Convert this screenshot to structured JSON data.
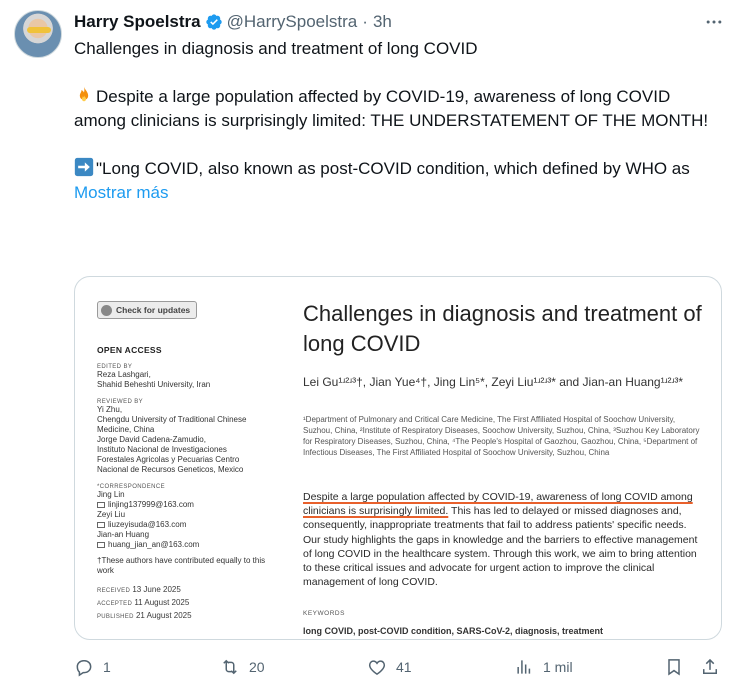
{
  "author": {
    "name": "Harry Spoelstra",
    "handle": "@HarrySpoelstra",
    "time": "3h"
  },
  "tweet": {
    "line1": "Challenges in diagnosis and treatment of long COVID",
    "para2": "Despite a large population affected by COVID-19, awareness of long COVID among clinicians is surprisingly limited: THE UNDERSTATEMENT OF THE MONTH!",
    "para3": "\"Long COVID, also known as post-COVID condition, which defined by WHO as",
    "show_more": "Mostrar más"
  },
  "paper": {
    "check_updates": "Check for updates",
    "open_access": "OPEN ACCESS",
    "edited_by_label": "EDITED BY",
    "edited_by": [
      "Reza Lashgari,",
      "Shahid Beheshti University, Iran"
    ],
    "reviewed_by_label": "REVIEWED BY",
    "reviewed_by": [
      "Yi Zhu,",
      "Chengdu University of Traditional Chinese",
      "Medicine, China",
      "Jorge David Cadena-Zamudio,",
      "Instituto Nacional de Investigaciones",
      "Forestales Agricolas y Pecuarias Centro",
      "Nacional de Recursos Geneticos, Mexico"
    ],
    "correspondence_label": "*CORRESPONDENCE",
    "correspondence": [
      {
        "name": "Jing Lin",
        "email": "linjing137999@163.com"
      },
      {
        "name": "Zeyi Liu",
        "email": "liuzeyisuda@163.com"
      },
      {
        "name": "Jian-an Huang",
        "email": "huang_jian_an@163.com"
      }
    ],
    "contrib_note": "†These authors have contributed equally to this work",
    "received_label": "RECEIVED",
    "received": "13 June 2025",
    "accepted_label": "ACCEPTED",
    "accepted": "11 August 2025",
    "published_label": "PUBLISHED",
    "published": "21 August 2025",
    "title": "Challenges in diagnosis and treatment of long COVID",
    "authors": "Lei Gu¹ʴ²ʴ³†, Jian Yue⁴†, Jing Lin⁵*, Zeyi Liu¹ʴ²ʴ³* and Jian-an Huang¹ʴ²ʴ³*",
    "affiliations": "¹Department of Pulmonary and Critical Care Medicine, The First Affiliated Hospital of Soochow University, Suzhou, China, ²Institute of Respiratory Diseases, Soochow University, Suzhou, China, ³Suzhou Key Laboratory for Respiratory Diseases, Suzhou, China, ⁴The People's Hospital of Gaozhou, Gaozhou, China, ⁵Department of Infectious Diseases, The First Affiliated Hospital of Soochow University, Suzhou, China",
    "abstract_highlight": "Despite a large population affected by COVID-19, awareness of long COVID among clinicians is surprisingly limited.",
    "abstract_rest": " This has led to delayed or missed diagnoses and, consequently, inappropriate treatments that fail to address patients' specific needs. Our study highlights the gaps in knowledge and the barriers to effective management of long COVID in the healthcare system. Through this work, we aim to bring attention to these critical issues and advocate for urgent action to improve the clinical management of long COVID.",
    "keywords_label": "KEYWORDS",
    "keywords": "long COVID, post-COVID condition, SARS-CoV-2, diagnosis, treatment"
  },
  "actions": {
    "replies": "1",
    "reposts": "20",
    "likes": "41",
    "views": "1 mil"
  },
  "colors": {
    "link": "#1d9bf0",
    "muted": "#536471",
    "highlight_underline": "#e8602c"
  }
}
